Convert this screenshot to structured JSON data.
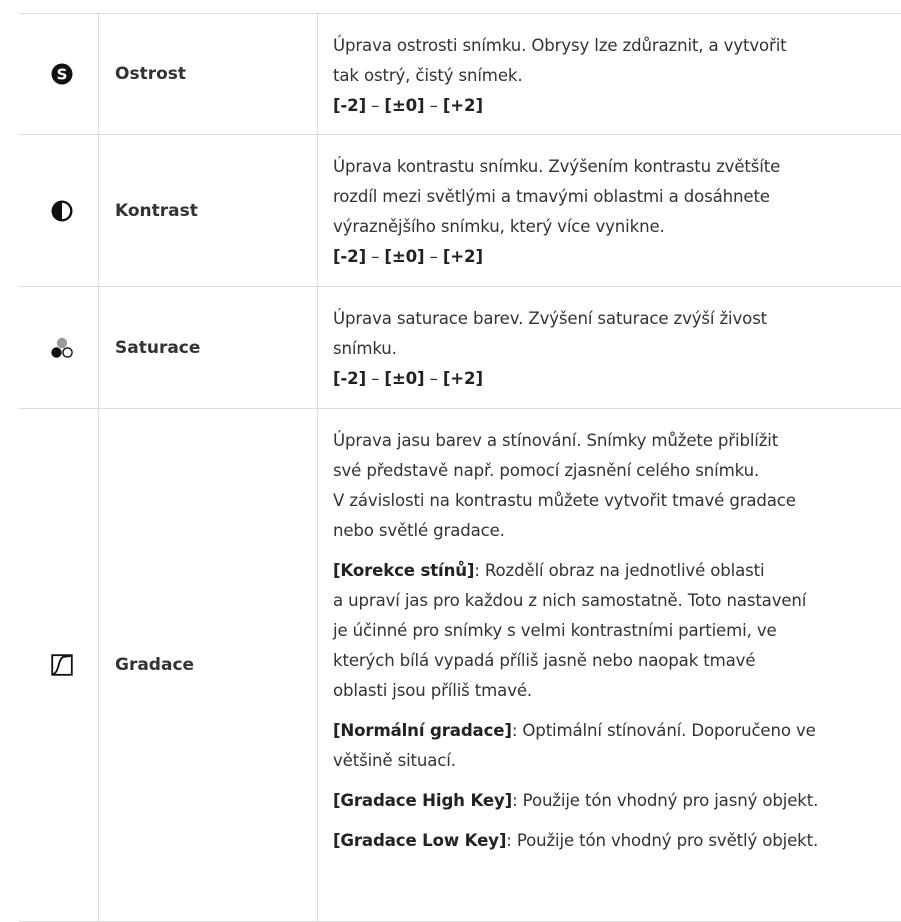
{
  "rows": [
    {
      "icon": "sharpness-icon",
      "name": "Ostrost",
      "lines": [
        "Úprava ostrosti snímku. Obrysy lze zdůraznit, a vytvořit",
        "tak ostrý, čistý snímek."
      ],
      "range": {
        "min": "[-2]",
        "sep": " – ",
        "mid": "[±0]",
        "max": "[+2]"
      }
    },
    {
      "icon": "contrast-icon",
      "name": "Kontrast",
      "lines": [
        "Úprava kontrastu snímku. Zvýšením kontrastu zvětšíte",
        "rozdíl mezi světlými a tmavými oblastmi a dosáhnete",
        "výraznějšího snímku, který více vynikne."
      ],
      "range": {
        "min": "[-2]",
        "sep": " – ",
        "mid": "[±0]",
        "max": "[+2]"
      }
    },
    {
      "icon": "saturation-icon",
      "name": "Saturace",
      "lines": [
        "Úprava saturace barev. Zvýšení saturace zvýší živost",
        "snímku."
      ],
      "range": {
        "min": "[-2]",
        "sep": " – ",
        "mid": "[±0]",
        "max": "[+2]"
      }
    },
    {
      "icon": "gradation-icon",
      "name": "Gradace",
      "intro": [
        "Úprava jasu barev a stínování. Snímky můžete přiblížit",
        "své představě např. pomocí zjasnění celého snímku.",
        "V závislosti na kontrastu můžete vytvořit tmavé gradace",
        "nebo světlé gradace."
      ],
      "options": [
        {
          "label": "[Korekce stínů]",
          "first": ": Rozdělí obraz na jednotlivé oblasti",
          "rest": [
            "a upraví jas pro každou z nich samostatně. Toto nastavení",
            "je účinné pro snímky s velmi kontrastními partiemi, ve",
            "kterých bílá vypadá příliš jasně nebo naopak tmavé",
            "oblasti jsou příliš tmavé."
          ]
        },
        {
          "label": "[Normální gradace]",
          "first": ": Optimální stínování. Doporučeno ve",
          "rest": [
            "většině situací."
          ]
        },
        {
          "label": "[Gradace High Key]",
          "first": ": Použije tón vhodný pro jasný objekt.",
          "rest": []
        },
        {
          "label": "[Gradace Low Key]",
          "first": ": Použije tón vhodný pro světlý objekt.",
          "rest": []
        }
      ]
    }
  ]
}
